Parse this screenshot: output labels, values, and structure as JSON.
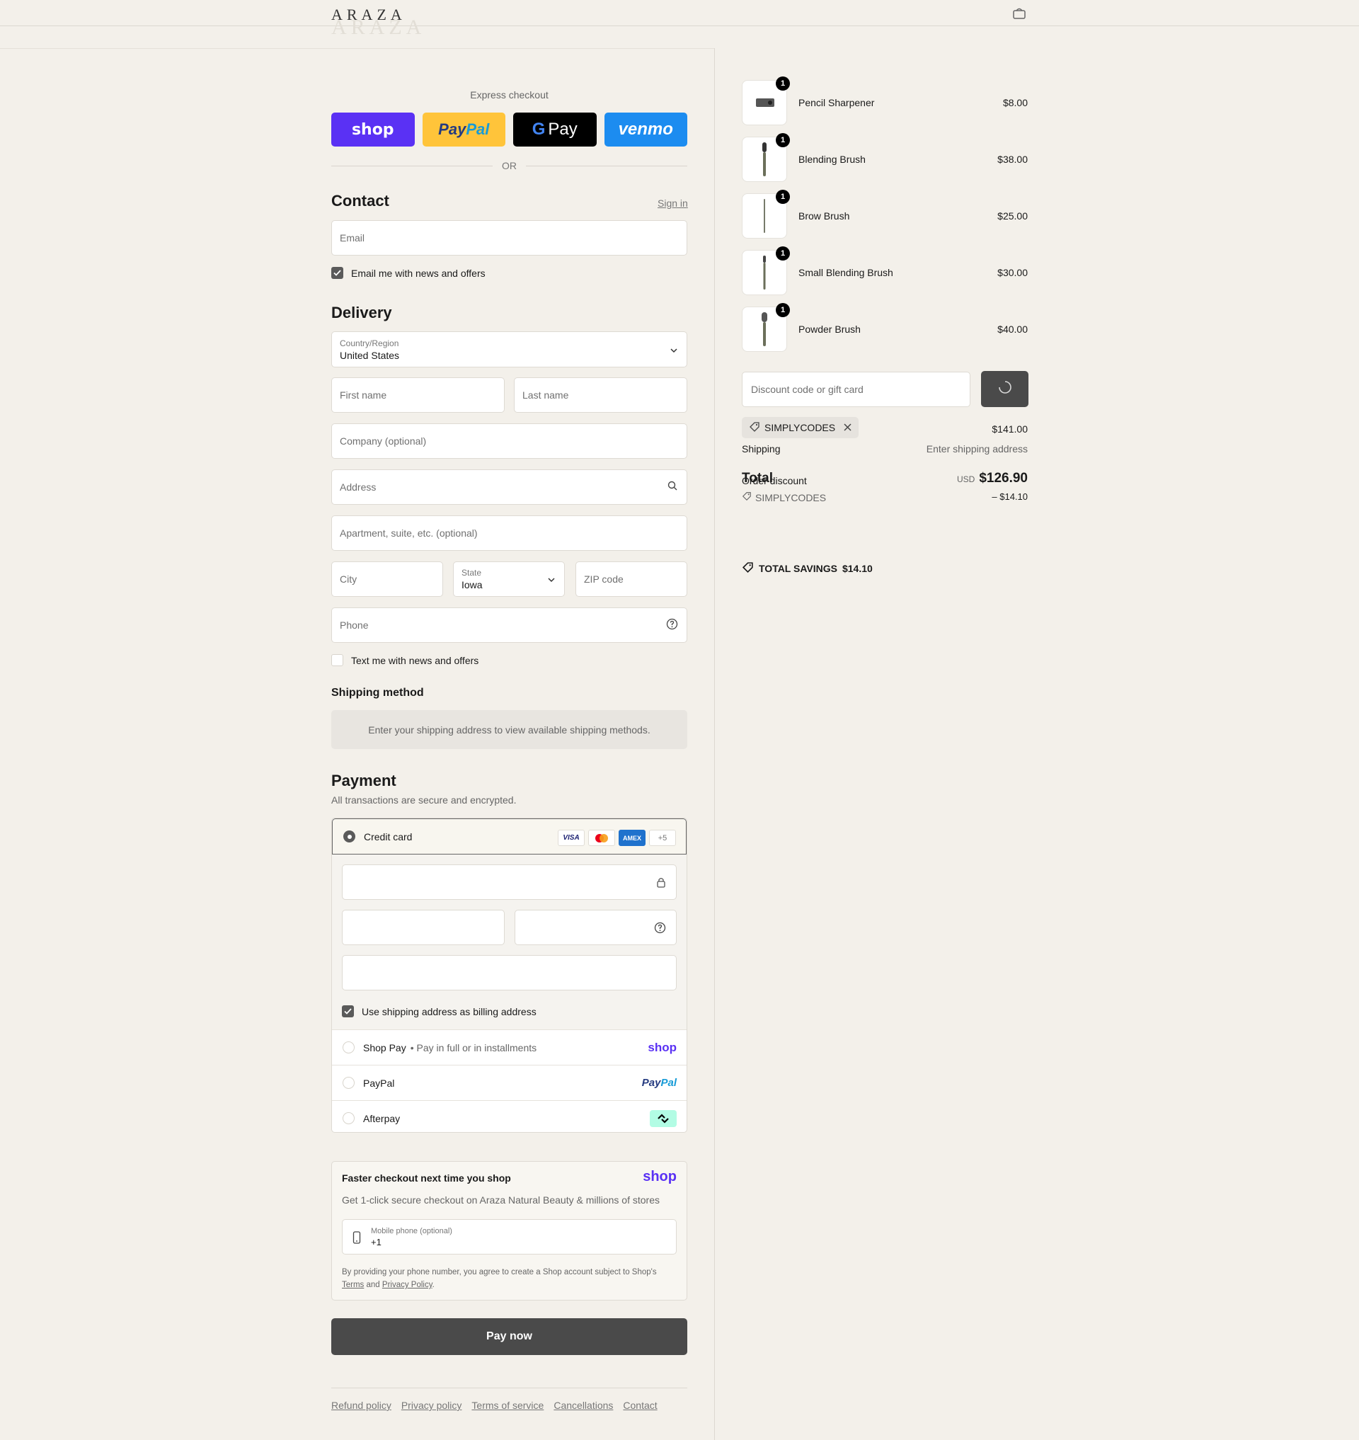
{
  "brand": {
    "logo": "ARAZA"
  },
  "express": {
    "title": "Express checkout",
    "shop": "shop",
    "paypal_a": "Pay",
    "paypal_b": "Pal",
    "gpay": "Pay",
    "venmo": "venmo",
    "or": "OR"
  },
  "contact": {
    "title": "Contact",
    "signin": "Sign in",
    "email_placeholder": "Email",
    "email_opt": "Email me with news and offers"
  },
  "delivery": {
    "title": "Delivery",
    "country_label": "Country/Region",
    "country_value": "United States",
    "first_name": "First name",
    "last_name": "Last name",
    "company": "Company (optional)",
    "address": "Address",
    "apartment": "Apartment, suite, etc. (optional)",
    "city": "City",
    "state_label": "State",
    "state_value": "Iowa",
    "zip": "ZIP code",
    "phone": "Phone",
    "text_opt": "Text me with news and offers"
  },
  "shipping": {
    "title": "Shipping method",
    "info": "Enter your shipping address to view available shipping methods."
  },
  "payment": {
    "title": "Payment",
    "subtitle": "All transactions are secure and encrypted.",
    "credit_card": "Credit card",
    "cards": [
      "VISA",
      "",
      "AMEX",
      "+5"
    ],
    "billing_same": "Use shipping address as billing address",
    "shop_pay": "Shop Pay",
    "shop_pay_sub": "Pay in full or in installments",
    "shop_logo": "shop",
    "paypal": "PayPal",
    "paypal_logo_a": "Pay",
    "paypal_logo_b": "Pal",
    "afterpay": "Afterpay"
  },
  "shop_promo": {
    "title": "Faster checkout next time you shop",
    "logo": "shop",
    "desc": "Get 1-click secure checkout on Araza Natural Beauty & millions of stores",
    "phone_label": "Mobile phone (optional)",
    "phone_value": "+1",
    "legal_a": "By providing your phone number, you agree to create a Shop account subject to Shop's",
    "terms": "Terms",
    "and": "and",
    "privacy": "Privacy Policy",
    "dot": "."
  },
  "pay_now": "Pay now",
  "footer": [
    "Refund policy",
    "Privacy policy",
    "Terms of service",
    "Cancellations",
    "Contact"
  ],
  "cart": {
    "items": [
      {
        "name": "Pencil Sharpener",
        "price": "$8.00",
        "qty": "1"
      },
      {
        "name": "Blending Brush",
        "price": "$38.00",
        "qty": "1"
      },
      {
        "name": "Brow Brush",
        "price": "$25.00",
        "qty": "1"
      },
      {
        "name": "Small Blending Brush",
        "price": "$30.00",
        "qty": "1"
      },
      {
        "name": "Powder Brush",
        "price": "$40.00",
        "qty": "1"
      }
    ],
    "discount_placeholder": "Discount code or gift card",
    "applied_code": "SIMPLYCODES",
    "subtotal": "$141.00",
    "shipping_label": "Shipping",
    "shipping_value": "Enter shipping address",
    "total_label": "Total",
    "order_discount_label": "Order discount",
    "currency": "USD",
    "total": "$126.90",
    "discount_code": "SIMPLYCODES",
    "discount_value": "– $14.10",
    "savings_label": "TOTAL SAVINGS",
    "savings_value": "$14.10"
  },
  "colors": {
    "background": "#f3f0ea",
    "shop": "#5a31f4",
    "paypal": "#ffc43a",
    "venmo": "#1c8cf0",
    "pay_button": "#4a4a4a"
  }
}
